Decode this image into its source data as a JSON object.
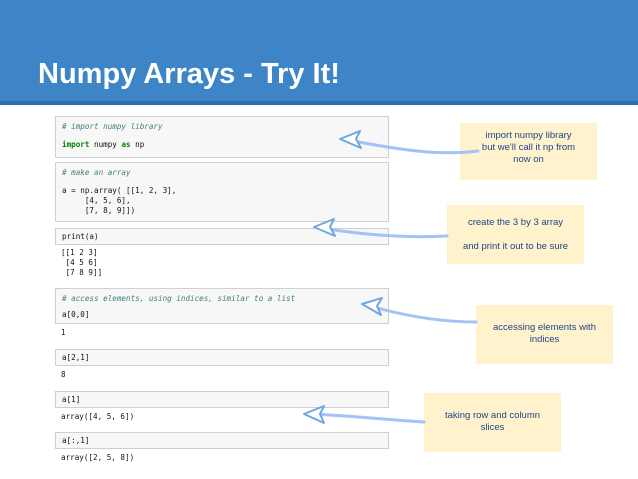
{
  "slide": {
    "title": "Numpy Arrays - Try It!",
    "colors": {
      "header": "#3d85c6",
      "note_bg": "#fff2cc",
      "note_text": "#1c4587",
      "arrow": "#a4c2f4"
    }
  },
  "code": {
    "cell1": [
      "# import numpy library",
      "import numpy as np"
    ],
    "cell2": [
      "# make an array",
      "a = np.array( [[1, 2, 3],",
      "     [4, 5, 6],",
      "     [7, 8, 9]])"
    ],
    "cell3": [
      "print(a)"
    ],
    "out3": [
      "[[1 2 3]",
      " [4 5 6]",
      " [7 8 9]]"
    ],
    "cell4": [
      "# access elements, using indices, similar to a list",
      "",
      "a[0,0]"
    ],
    "out4": [
      "1"
    ],
    "cell5": [
      "a[2,1]"
    ],
    "out5": [
      "8"
    ],
    "cell6": [
      "a[1]"
    ],
    "out6": [
      "array([4, 5, 6])"
    ],
    "cell7": [
      "a[:,1]"
    ],
    "out7": [
      "array([2, 5, 8])"
    ]
  },
  "notes": {
    "note1": [
      "import numpy library",
      "but we'll call it np from",
      "now on"
    ],
    "note2": [
      "create the 3 by 3 array",
      "",
      "and print it out to be sure"
    ],
    "note3": [
      "accessing elements with",
      "indices"
    ],
    "note4": [
      "taking row and column",
      "slices"
    ]
  }
}
